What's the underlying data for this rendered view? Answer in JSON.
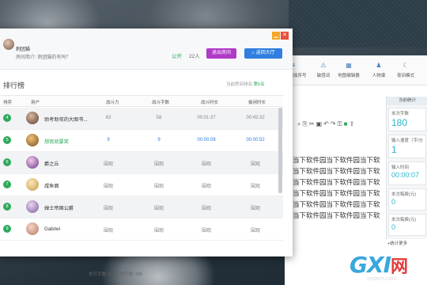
{
  "room": {
    "name": "刺团猫",
    "intro": "房间简介: 刺团猫的有吗？",
    "status": "公开",
    "count": "22人",
    "exit_label": "退出房间",
    "back_label": "返回大厅"
  },
  "leaderboard": {
    "title": "排行榜",
    "my_rank_prefix": "当前房间排名:",
    "my_rank_value": "第5名",
    "columns": [
      "排序",
      "用户",
      "战斗力",
      "战斗字数",
      "战斗时长",
      "偷闲时长"
    ],
    "rows": [
      {
        "rank": "4",
        "name": "助考助攻的大图书...",
        "power": "63",
        "words": "58",
        "fight_time": "00:01:37",
        "idle_time": "00:45:32",
        "highlight": false
      },
      {
        "rank": "5",
        "name": "想我就要笑",
        "power": "9",
        "words": "9",
        "fight_time": "00:00:08",
        "idle_time": "00:00:52",
        "highlight": true
      },
      {
        "rank": "6",
        "name": "爵之丘",
        "power": "围观",
        "words": "围观",
        "fight_time": "围观",
        "idle_time": "围观",
        "highlight": false
      },
      {
        "rank": "7",
        "name": "咸鱼面",
        "power": "围观",
        "words": "围观",
        "fight_time": "围观",
        "idle_time": "围观",
        "highlight": false
      },
      {
        "rank": "8",
        "name": "婵士帝国公爵",
        "power": "围观",
        "words": "围观",
        "fight_time": "围观",
        "idle_time": "围观",
        "highlight": false
      },
      {
        "rank": "9",
        "name": "Gabriel",
        "power": "围观",
        "words": "围观",
        "fight_time": "围观",
        "idle_time": "围观",
        "highlight": false
      }
    ]
  },
  "editor": {
    "toolbar": [
      "比最添加序号",
      "敏感词",
      "地图编辑器",
      "人物谱",
      "夜间模式"
    ],
    "lines": [
      "当下软件园当下软件园当下软",
      "当下软件园当下软件园当下软",
      "当下软件园当下软件园当下软",
      "当下软件园当下软件园当下软",
      "当下软件园当下软件园当下软",
      "当下软件园当下软件园当下软"
    ],
    "stats_title": "当前统计",
    "stats": [
      {
        "label": "本次字数",
        "value": "180"
      },
      {
        "label": "输入速度（字/分",
        "value": "1"
      },
      {
        "label": "输入时间",
        "value": "00:00:07"
      },
      {
        "label": "本次稿费(元)",
        "value": "0"
      },
      {
        "label": "本次稿费(元)",
        "value": "0"
      }
    ],
    "more_label": "+统计更多",
    "status_words": "本节字数: 5",
    "status_total": "本章字数: 185"
  },
  "watermark": {
    "main": "GXI",
    "cn": "网",
    "domain": "system.com"
  }
}
